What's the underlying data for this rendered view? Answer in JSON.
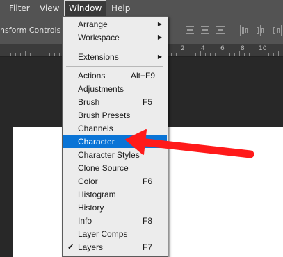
{
  "menubar": {
    "items": [
      {
        "label": "Filter"
      },
      {
        "label": "View"
      },
      {
        "label": "Window"
      },
      {
        "label": "Help"
      }
    ]
  },
  "options_bar": {
    "label": "nsform Controls"
  },
  "ruler": {
    "numbers": [
      "2",
      "4",
      "6",
      "8",
      "10"
    ]
  },
  "window_menu": {
    "top_items": [
      {
        "label": "Arrange",
        "submenu": true
      },
      {
        "label": "Workspace",
        "submenu": true
      }
    ],
    "extensions": {
      "label": "Extensions",
      "submenu": true
    },
    "items": [
      {
        "label": "Actions",
        "shortcut": "Alt+F9"
      },
      {
        "label": "Adjustments",
        "shortcut": ""
      },
      {
        "label": "Brush",
        "shortcut": "F5"
      },
      {
        "label": "Brush Presets",
        "shortcut": ""
      },
      {
        "label": "Channels",
        "shortcut": ""
      },
      {
        "label": "Character",
        "shortcut": "",
        "selected": true
      },
      {
        "label": "Character Styles",
        "shortcut": ""
      },
      {
        "label": "Clone Source",
        "shortcut": ""
      },
      {
        "label": "Color",
        "shortcut": "F6"
      },
      {
        "label": "Histogram",
        "shortcut": ""
      },
      {
        "label": "History",
        "shortcut": ""
      },
      {
        "label": "Info",
        "shortcut": "F8"
      },
      {
        "label": "Layer Comps",
        "shortcut": ""
      },
      {
        "label": "Layers",
        "shortcut": "F7",
        "checked": true
      }
    ]
  },
  "colors": {
    "selection": "#0a74d6",
    "annotation_arrow": "#ff1a1a",
    "menu_bg": "#ececec",
    "chrome_bg": "#535353"
  },
  "icons": {
    "submenu": "triangle-right-icon",
    "check": "checkmark-icon"
  }
}
